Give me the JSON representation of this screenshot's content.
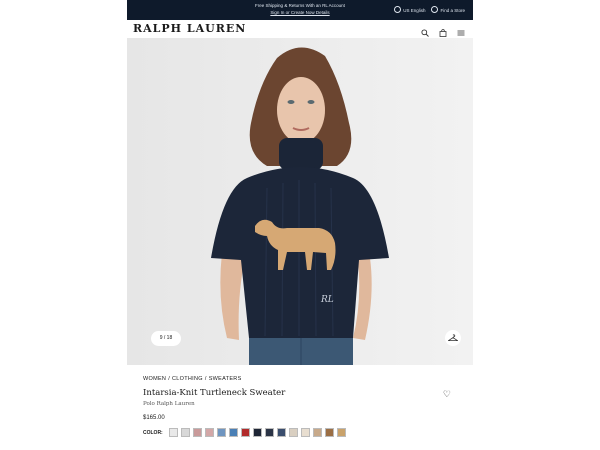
{
  "promo": {
    "line1": "Free Shipping & Returns With an RL Account",
    "line2": "Sign In or Create Now Details",
    "lang": "US English",
    "stores": "Find a Store"
  },
  "header": {
    "logo": "RALPH LAUREN"
  },
  "hero": {
    "pager": "9 / 18"
  },
  "product": {
    "breadcrumb": [
      "WOMEN",
      "CLOTHING",
      "SWEATERS"
    ],
    "title": "Intarsia-Knit Turtleneck Sweater",
    "brand": "Polo Ralph Lauren",
    "price": "$165.00",
    "color_label": "COLOR:",
    "swatches": [
      "#e9e9e9",
      "#d8d8d8",
      "#c99a9a",
      "#d3a7a7",
      "#6f95c0",
      "#4a7fb5",
      "#b12b2b",
      "#1e2535",
      "#2b3446",
      "#3a4d6d",
      "#d9cfc1",
      "#e8ded0",
      "#c7a98a",
      "#9b6e44",
      "#c9a26b"
    ]
  }
}
